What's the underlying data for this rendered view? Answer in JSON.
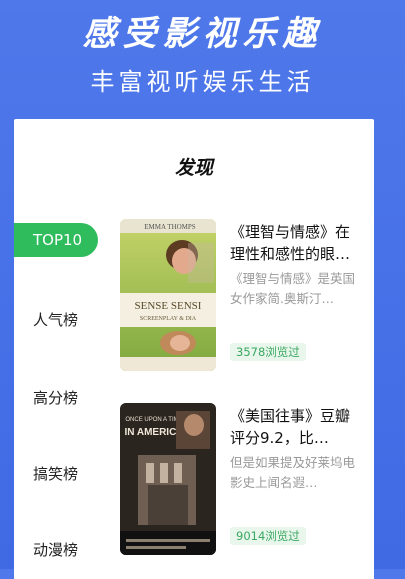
{
  "promo": {
    "title": "感受影视乐趣",
    "subtitle": "丰富视听娱乐生活"
  },
  "page": {
    "title": "发现"
  },
  "sidebar": {
    "items": [
      {
        "label": "TOP10"
      },
      {
        "label": "人气榜"
      },
      {
        "label": "高分榜"
      },
      {
        "label": "搞笑榜"
      },
      {
        "label": "动漫榜"
      }
    ]
  },
  "cards": [
    {
      "title": "《理智与情感》在理性和感性的眼…",
      "desc": "《理智与情感》是英国女作家简.奥斯汀…",
      "views": "3578浏览过",
      "poster": {
        "top_text": "EMMA THOMPS",
        "main_text": "SENSE SENSI",
        "sub_text": "SCREENPLAY & DIA"
      }
    },
    {
      "title": "《美国往事》豆瓣评分9.2，比…",
      "desc": "但是如果提及好莱坞电影史上闻名遐…",
      "views": "9014浏览过",
      "poster": {
        "line1": "ONCE UPON A TIME",
        "line2": "IN AMERICA"
      }
    }
  ],
  "colors": {
    "background": "#4f78ea",
    "accent_green": "#2ebc5c"
  }
}
